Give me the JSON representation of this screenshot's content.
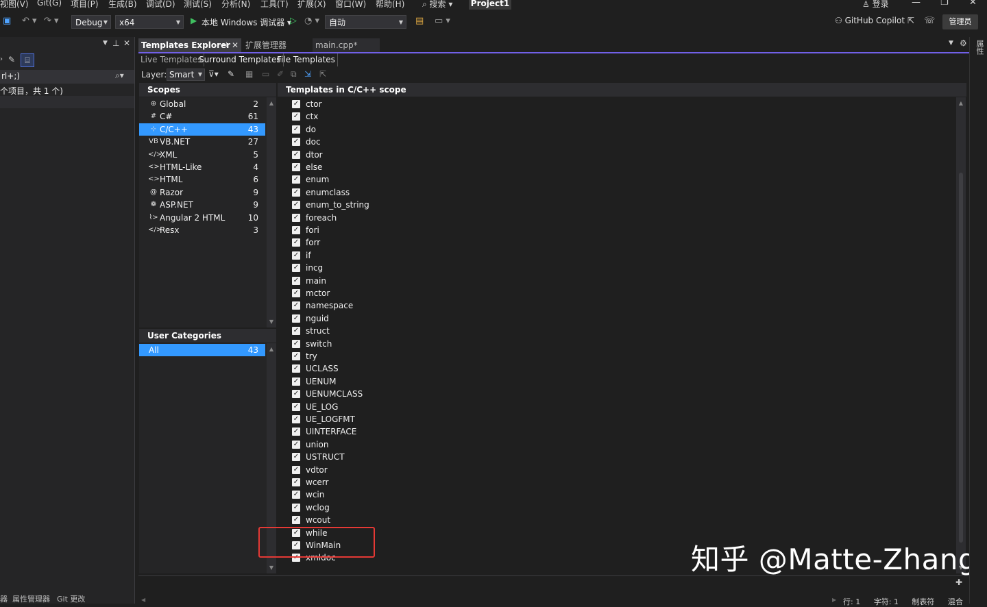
{
  "menu": {
    "items": [
      "视图(V)",
      "Git(G)",
      "项目(P)",
      "生成(B)",
      "调试(D)",
      "测试(S)",
      "分析(N)",
      "工具(T)",
      "扩展(X)",
      "窗口(W)",
      "帮助(H)"
    ],
    "search_label": "搜索",
    "project_title": "Project1",
    "login_label": "登录"
  },
  "toolbar": {
    "config": "Debug",
    "platform": "x64",
    "run_label": "本地 Windows 调试器",
    "auto_combo": "自动",
    "copilot_label": "GitHub Copilot",
    "admin_label": "管理员"
  },
  "left_panel": {
    "search_text": "rl+;)",
    "items_summary": "个项目，共 1 个)",
    "bottom_tabs": [
      "属性管理器",
      "Git 更改"
    ]
  },
  "tabs": {
    "active": "Templates Explorer",
    "ext_manager": "扩展管理器",
    "doc": "main.cpp*"
  },
  "subtabs": [
    "Live Templates",
    "Surround Templates",
    "File Templates"
  ],
  "layer": {
    "label": "Layer:",
    "value": "Smart"
  },
  "scopes": {
    "header": "Scopes",
    "items": [
      {
        "icon": "globe-icon",
        "glyph": "⊕",
        "label": "Global",
        "count": "2"
      },
      {
        "icon": "csharp-icon",
        "glyph": "#",
        "label": "C#",
        "count": "61"
      },
      {
        "icon": "cpp-icon",
        "glyph": "⊹",
        "label": "C/C++",
        "count": "43",
        "selected": true
      },
      {
        "icon": "vbnet-icon",
        "glyph": "VB",
        "label": "VB.NET",
        "count": "27"
      },
      {
        "icon": "xml-icon",
        "glyph": "</>",
        "label": "XML",
        "count": "5"
      },
      {
        "icon": "htmllike-icon",
        "glyph": "<>",
        "label": "HTML-Like",
        "count": "4"
      },
      {
        "icon": "html-icon",
        "glyph": "<>",
        "label": "HTML",
        "count": "6"
      },
      {
        "icon": "razor-icon",
        "glyph": "@",
        "label": "Razor",
        "count": "9"
      },
      {
        "icon": "aspnet-icon",
        "glyph": "❁",
        "label": "ASP.NET",
        "count": "9"
      },
      {
        "icon": "angular-icon",
        "glyph": "⌇>",
        "label": "Angular 2 HTML",
        "count": "10"
      },
      {
        "icon": "resx-icon",
        "glyph": "</>",
        "label": "Resx",
        "count": "3"
      }
    ]
  },
  "user_categories": {
    "header": "User Categories",
    "items": [
      {
        "label": "All",
        "count": "43",
        "selected": true
      }
    ]
  },
  "templates": {
    "header": "Templates in C/C++ scope",
    "items": [
      "ctor",
      "ctx",
      "do",
      "doc",
      "dtor",
      "else",
      "enum",
      "enumclass",
      "enum_to_string",
      "foreach",
      "fori",
      "forr",
      "if",
      "incg",
      "main",
      "mctor",
      "namespace",
      "nguid",
      "struct",
      "switch",
      "try",
      "UCLASS",
      "UENUM",
      "UENUMCLASS",
      "UE_LOG",
      "UE_LOGFMT",
      "UINTERFACE",
      "union",
      "USTRUCT",
      "vdtor",
      "wcerr",
      "wcin",
      "wclog",
      "wcout",
      "while",
      "WinMain",
      "xmldoc"
    ]
  },
  "watermark": "知乎 @Matte-Zhang",
  "status": [
    "行: 1",
    "字符: 1",
    "制表符",
    "混合"
  ],
  "colors": {
    "accent": "#7160e8",
    "selection": "#3399ff",
    "highlight": "#e53935"
  }
}
